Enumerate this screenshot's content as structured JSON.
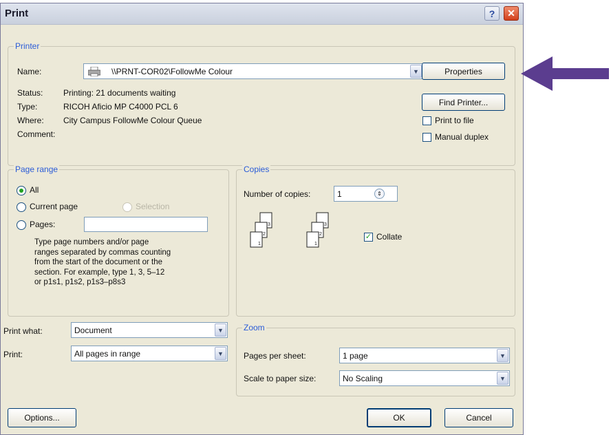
{
  "window": {
    "title": "Print",
    "help_glyph": "?",
    "close_glyph": "✕"
  },
  "printer": {
    "legend": "Printer",
    "name_label": "Name:",
    "name_value": "\\\\PRNT-COR02\\FollowMe Colour",
    "status_label": "Status:",
    "status_value": "Printing: 21 documents waiting",
    "type_label": "Type:",
    "type_value": "RICOH Aficio MP C4000 PCL 6",
    "where_label": "Where:",
    "where_value": "City Campus FollowMe Colour Queue",
    "comment_label": "Comment:",
    "properties_button": "Properties",
    "find_printer_button": "Find Printer...",
    "print_to_file_label": "Print to file",
    "manual_duplex_label": "Manual duplex"
  },
  "page_range": {
    "legend": "Page range",
    "all_label": "All",
    "current_page_label": "Current page",
    "selection_label": "Selection",
    "pages_label": "Pages:",
    "pages_value": "",
    "help": [
      "Type page numbers and/or page",
      "ranges separated by commas counting",
      "from the start of the document or the",
      "section. For example, type 1, 3, 5–12",
      "or p1s1, p1s2, p1s3–p8s3"
    ]
  },
  "copies": {
    "legend": "Copies",
    "number_label": "Number of copies:",
    "number_value": "1",
    "collate_label": "Collate"
  },
  "print_what": {
    "label": "Print what:",
    "value": "Document",
    "print_label": "Print:",
    "print_value": "All pages in range"
  },
  "zoom": {
    "legend": "Zoom",
    "pages_per_sheet_label": "Pages per sheet:",
    "pages_per_sheet_value": "1 page",
    "scale_label": "Scale to paper size:",
    "scale_value": "No Scaling"
  },
  "footer": {
    "options_button": "Options...",
    "ok_button": "OK",
    "cancel_button": "Cancel"
  },
  "colors": {
    "legend": "#2a5bd7",
    "arrow": "#5b3d8f",
    "dialog_bg": "#ECE9D8"
  }
}
